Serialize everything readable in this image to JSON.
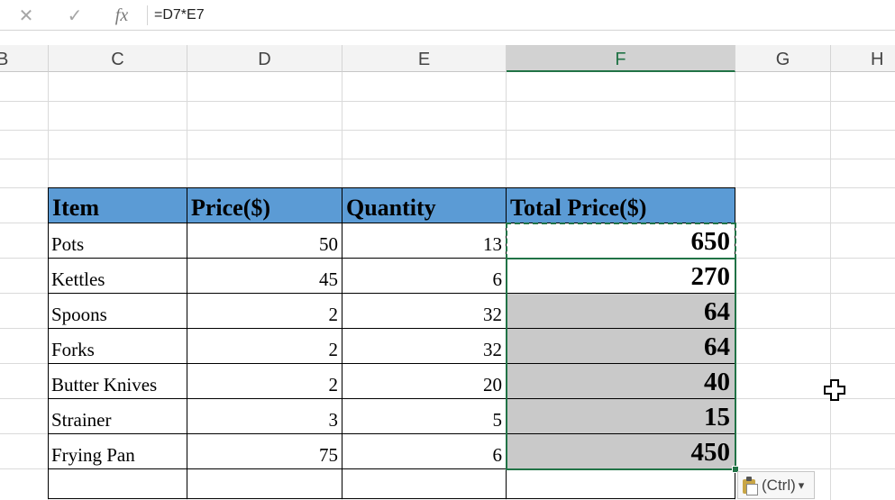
{
  "formula_bar": {
    "cancel_icon": "✕",
    "enter_icon": "✓",
    "fx_label": "fx",
    "formula": "=D7*E7"
  },
  "columns": [
    "B",
    "C",
    "D",
    "E",
    "F",
    "G",
    "H"
  ],
  "selected_column": "F",
  "table": {
    "headers": [
      "Item",
      "Price($)",
      "Quantity",
      "Total Price($)"
    ],
    "rows": [
      {
        "item": "Pots",
        "price": "50",
        "qty": "13",
        "total": "650"
      },
      {
        "item": "Kettles",
        "price": "45",
        "qty": "6",
        "total": "270"
      },
      {
        "item": "Spoons",
        "price": "2",
        "qty": "32",
        "total": "64"
      },
      {
        "item": "Forks",
        "price": "2",
        "qty": "32",
        "total": "64"
      },
      {
        "item": "Butter Knives",
        "price": "2",
        "qty": "20",
        "total": "40"
      },
      {
        "item": "Strainer",
        "price": "3",
        "qty": "5",
        "total": "15"
      },
      {
        "item": "Frying Pan",
        "price": "75",
        "qty": "6",
        "total": "450"
      }
    ]
  },
  "paste_options": {
    "label": "(Ctrl)",
    "icon": "clipboard-icon",
    "caret": "▾"
  },
  "colors": {
    "header_fill": "#5b9bd5",
    "selection": "#217346",
    "shaded_cell": "#c9c9c9"
  }
}
